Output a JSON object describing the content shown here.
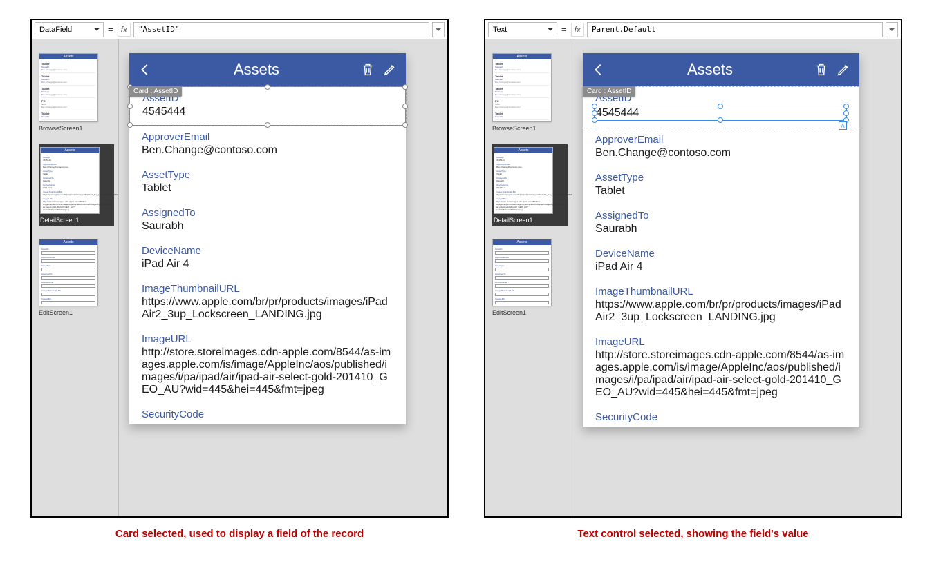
{
  "left": {
    "propertySelect": "DataField",
    "formula": "\"AssetID\"",
    "selectionTag": "Card : AssetID",
    "caption": "Card selected, used to display a field of the record"
  },
  "right": {
    "propertySelect": "Text",
    "formula": "Parent.Default",
    "selectionTag": "Card : AssetID",
    "caption": "Text control selected, showing the field's value"
  },
  "phone": {
    "title": "Assets",
    "fields": [
      {
        "label": "AssetID",
        "value": "4545444"
      },
      {
        "label": "ApproverEmail",
        "value": "Ben.Change@contoso.com"
      },
      {
        "label": "AssetType",
        "value": "Tablet"
      },
      {
        "label": "AssignedTo",
        "value": "Saurabh"
      },
      {
        "label": "DeviceName",
        "value": "iPad Air 4"
      },
      {
        "label": "ImageThumbnailURL",
        "value": "https://www.apple.com/br/pr/products/images/iPadAir2_3up_Lockscreen_LANDING.jpg"
      },
      {
        "label": "ImageURL",
        "value": "http://store.storeimages.cdn-apple.com/8544/as-images.apple.com/is/image/AppleInc/aos/published/images/i/pa/ipad/air/ipad-air-select-gold-201410_GEO_AU?wid=445&hei=445&fmt=jpeg"
      },
      {
        "label": "SecurityCode",
        "value": ""
      }
    ]
  },
  "thumbs": {
    "browse": {
      "label": "BrowseScreen1",
      "title": "Assets",
      "rows": [
        "Tablet",
        "Tablet",
        "Tablet",
        "PC",
        "Tablet"
      ]
    },
    "detail": {
      "label": "DetailScreen1",
      "title": "Assets"
    },
    "edit": {
      "label": "EditScreen1",
      "title": "Assets"
    }
  }
}
